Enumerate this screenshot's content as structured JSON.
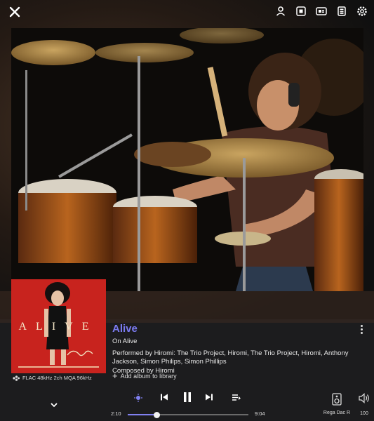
{
  "top_bar": {
    "close_icon": "close-icon",
    "icons": [
      "user-icon",
      "zone-icon",
      "queue-icon",
      "radio-icon",
      "settings-icon"
    ]
  },
  "album_art": {
    "lettering": "ALIVE",
    "signature": "Hiromi",
    "small_text": "THE TRIO PROJECT FEATURING ANTHONY JACKSON & SIMON PHILLIPS"
  },
  "track": {
    "title": "Alive",
    "album_line": "On Alive",
    "performed_by": "Performed by Hiromi: The Trio Project, Hiromi, The Trio Project, Hiromi, Anthony Jackson, Simon Philips, Simon Phillips",
    "composed_by": "Composed by Hiromi"
  },
  "format": {
    "text": "FLAC 48kHz 2ch  MQA 96kHz"
  },
  "add_album_label": "Add album to library",
  "playback": {
    "elapsed": "2:10",
    "duration": "9:04",
    "progress_fraction": 0.239
  },
  "device": {
    "name": "Rega Dac R"
  },
  "volume": {
    "level": "100"
  },
  "colors": {
    "accent": "#7b7bf2",
    "background": "#1c1c1e"
  }
}
